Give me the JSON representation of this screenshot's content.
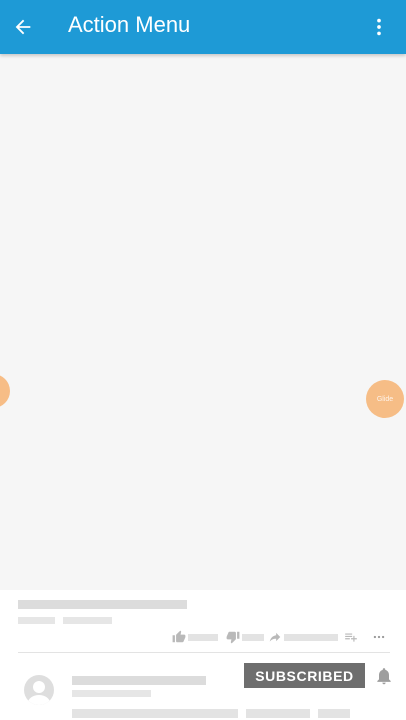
{
  "app_bar": {
    "title": "Action Menu",
    "background": "#1e9ad6",
    "back_icon": "arrow-back-icon",
    "overflow_icon": "more-vert-icon"
  },
  "floating": {
    "right_label": "Glide",
    "color": "#f7b77a"
  },
  "video_info": {
    "subscribe_label": "SUBSCRIBED",
    "icons": [
      "thumb-up-icon",
      "thumb-down-icon",
      "share-icon",
      "add-to-playlist-icon",
      "more-horiz-icon",
      "bell-icon"
    ]
  }
}
